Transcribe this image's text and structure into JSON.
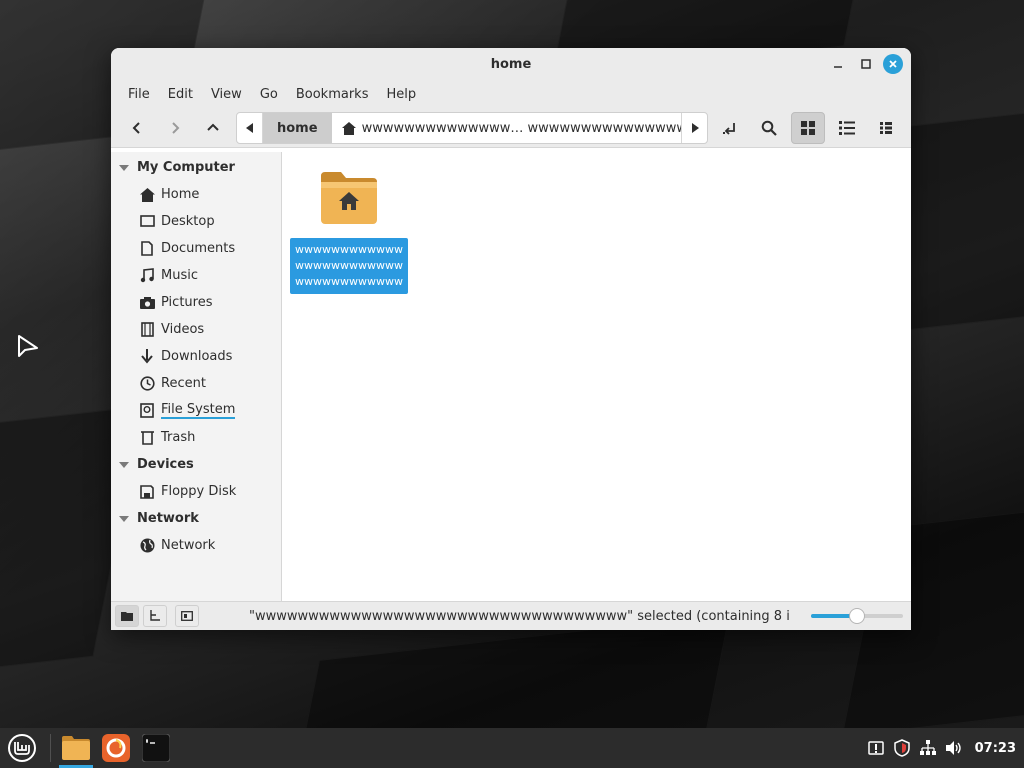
{
  "window": {
    "title": "home"
  },
  "menu": [
    "File",
    "Edit",
    "View",
    "Go",
    "Bookmarks",
    "Help"
  ],
  "pathbar": {
    "home_label": "home",
    "current_path": "wwwwwwwwwwwwww… wwwwwwwwwwwwwww"
  },
  "sidebar": {
    "sections": [
      {
        "title": "My Computer",
        "items": [
          {
            "label": "Home",
            "icon": "home-icon"
          },
          {
            "label": "Desktop",
            "icon": "desktop-icon"
          },
          {
            "label": "Documents",
            "icon": "documents-icon"
          },
          {
            "label": "Music",
            "icon": "music-icon"
          },
          {
            "label": "Pictures",
            "icon": "camera-icon"
          },
          {
            "label": "Videos",
            "icon": "film-icon"
          },
          {
            "label": "Downloads",
            "icon": "download-icon"
          },
          {
            "label": "Recent",
            "icon": "clock-icon"
          },
          {
            "label": "File System",
            "icon": "drive-icon"
          },
          {
            "label": "Trash",
            "icon": "trash-icon"
          }
        ]
      },
      {
        "title": "Devices",
        "items": [
          {
            "label": "Floppy Disk",
            "icon": "floppy-icon"
          }
        ]
      },
      {
        "title": "Network",
        "items": [
          {
            "label": "Network",
            "icon": "globe-icon"
          }
        ]
      }
    ]
  },
  "files": [
    {
      "name": "wwwwwwwwwwwwwwwwwwwwwwwwwwwwwwwwwwww",
      "icon": "home-folder-icon",
      "selected": true
    }
  ],
  "status": {
    "text": "\"wwwwwwwwwwwwwwwwwwwwwwwwwwwwwwwwwww\" selected (containing 8 i…",
    "zoom_level": 0.5
  },
  "taskbar": {
    "clock": "07:23"
  },
  "colors": {
    "accent": "#2aa0d8",
    "selection": "#2b9ae0",
    "folder": "#f0b454"
  }
}
